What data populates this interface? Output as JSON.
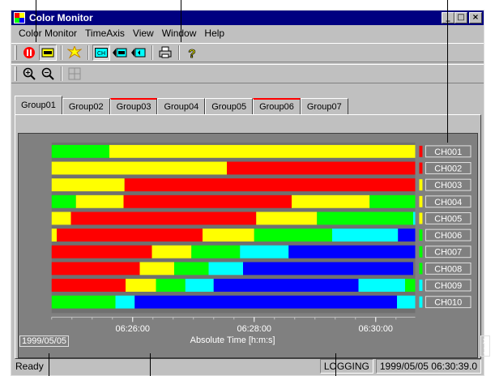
{
  "window": {
    "title": "Color Monitor",
    "minimize": "_",
    "maximize": "□",
    "close": "×"
  },
  "menu": [
    "Color Monitor",
    "TimeAxis",
    "View",
    "Window",
    "Help"
  ],
  "toolbar": {
    "row1": [
      "stop-icon",
      "monitor-icon",
      "burst-icon",
      "ch-icon",
      "channel-list-icon",
      "channel-scroll-icon",
      "print-icon",
      "help-icon"
    ],
    "row2": [
      "zoom-in-icon",
      "zoom-out-icon",
      "grid-icon"
    ]
  },
  "tabs": [
    {
      "label": "Group01",
      "active": true,
      "alert": false
    },
    {
      "label": "Group02",
      "active": false,
      "alert": false
    },
    {
      "label": "Group03",
      "active": false,
      "alert": true
    },
    {
      "label": "Group04",
      "active": false,
      "alert": false
    },
    {
      "label": "Group05",
      "active": false,
      "alert": false
    },
    {
      "label": "Group06",
      "active": false,
      "alert": true
    },
    {
      "label": "Group07",
      "active": false,
      "alert": false
    }
  ],
  "colors": {
    "red": "#ff0000",
    "yellow": "#ffff00",
    "green": "#00ff00",
    "cyan": "#00ffff",
    "blue": "#0000ff"
  },
  "chart_data": {
    "type": "timeline",
    "x_range": [
      "06:24:40",
      "06:30:39"
    ],
    "x_ticks": [
      "06:26:00",
      "06:28:00",
      "06:30:00"
    ],
    "xlabel": "Absolute Time [h:m:s]",
    "date": "1999/05/05",
    "zoom": "x 1",
    "channels": [
      {
        "name": "CH001",
        "current": "red",
        "segments": [
          [
            "06:24:40",
            "06:25:37",
            "green"
          ],
          [
            "06:25:37",
            "06:30:39",
            "yellow"
          ]
        ]
      },
      {
        "name": "CH002",
        "current": "red",
        "segments": [
          [
            "06:24:40",
            "06:27:33",
            "yellow"
          ],
          [
            "06:27:33",
            "06:30:39",
            "red"
          ]
        ]
      },
      {
        "name": "CH003",
        "current": "yellow",
        "segments": [
          [
            "06:24:40",
            "06:25:52",
            "yellow"
          ],
          [
            "06:25:52",
            "06:30:39",
            "red"
          ]
        ]
      },
      {
        "name": "CH004",
        "current": "yellow",
        "segments": [
          [
            "06:24:40",
            "06:25:04",
            "green"
          ],
          [
            "06:25:04",
            "06:25:51",
            "yellow"
          ],
          [
            "06:25:51",
            "06:28:37",
            "red"
          ],
          [
            "06:28:37",
            "06:29:54",
            "yellow"
          ],
          [
            "06:29:54",
            "06:30:39",
            "green"
          ]
        ]
      },
      {
        "name": "CH005",
        "current": "yellow",
        "segments": [
          [
            "06:24:40",
            "06:24:59",
            "yellow"
          ],
          [
            "06:24:59",
            "06:28:02",
            "red"
          ],
          [
            "06:28:02",
            "06:29:02",
            "yellow"
          ],
          [
            "06:29:02",
            "06:30:37",
            "green"
          ],
          [
            "06:30:37",
            "06:30:39",
            "cyan"
          ]
        ]
      },
      {
        "name": "CH006",
        "current": "green",
        "segments": [
          [
            "06:24:40",
            "06:24:45",
            "yellow"
          ],
          [
            "06:24:45",
            "06:27:09",
            "red"
          ],
          [
            "06:27:09",
            "06:28:00",
            "yellow"
          ],
          [
            "06:28:00",
            "06:29:17",
            "green"
          ],
          [
            "06:29:17",
            "06:30:22",
            "cyan"
          ],
          [
            "06:30:22",
            "06:30:39",
            "blue"
          ]
        ]
      },
      {
        "name": "CH007",
        "current": "green",
        "segments": [
          [
            "06:24:40",
            "06:26:19",
            "red"
          ],
          [
            "06:26:19",
            "06:26:58",
            "yellow"
          ],
          [
            "06:26:58",
            "06:27:46",
            "green"
          ],
          [
            "06:27:46",
            "06:28:34",
            "cyan"
          ],
          [
            "06:28:34",
            "06:30:39",
            "blue"
          ]
        ]
      },
      {
        "name": "CH008",
        "current": "green",
        "segments": [
          [
            "06:24:40",
            "06:26:07",
            "red"
          ],
          [
            "06:26:07",
            "06:26:41",
            "yellow"
          ],
          [
            "06:26:41",
            "06:27:15",
            "green"
          ],
          [
            "06:27:15",
            "06:27:49",
            "cyan"
          ],
          [
            "06:27:49",
            "06:30:37",
            "blue"
          ]
        ]
      },
      {
        "name": "CH009",
        "current": "cyan",
        "segments": [
          [
            "06:24:40",
            "06:25:53",
            "red"
          ],
          [
            "06:25:53",
            "06:26:23",
            "yellow"
          ],
          [
            "06:26:23",
            "06:26:52",
            "green"
          ],
          [
            "06:26:52",
            "06:27:20",
            "cyan"
          ],
          [
            "06:27:20",
            "06:29:43",
            "blue"
          ],
          [
            "06:29:43",
            "06:30:29",
            "cyan"
          ],
          [
            "06:30:29",
            "06:30:39",
            "green"
          ]
        ]
      },
      {
        "name": "CH010",
        "current": "cyan",
        "segments": [
          [
            "06:24:40",
            "06:25:43",
            "green"
          ],
          [
            "06:25:43",
            "06:26:02",
            "cyan"
          ],
          [
            "06:26:02",
            "06:30:21",
            "blue"
          ],
          [
            "06:30:21",
            "06:30:39",
            "cyan"
          ]
        ]
      }
    ]
  },
  "status": {
    "ready": "Ready",
    "mode": "LOGGING",
    "datetime": "1999/05/05 06:30:39.0"
  }
}
